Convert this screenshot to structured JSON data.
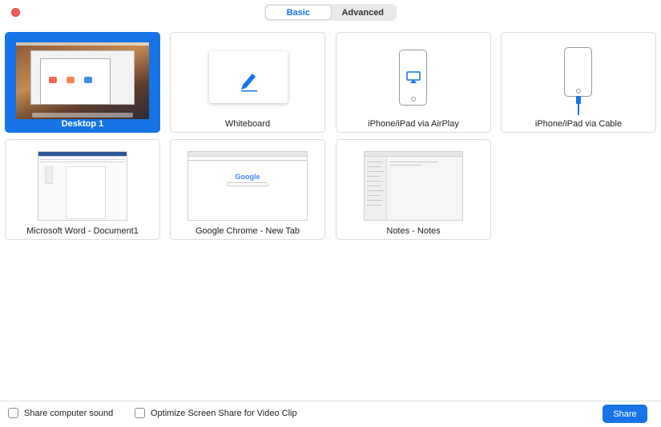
{
  "window": {
    "close_color": "#ee5d5b"
  },
  "tabs": {
    "basic": "Basic",
    "advanced": "Advanced",
    "active": "Basic"
  },
  "tiles": [
    {
      "label": "Desktop 1",
      "selected": true,
      "icon": "desktop-thumbnail"
    },
    {
      "label": "Whiteboard",
      "selected": false,
      "icon": "pen-icon"
    },
    {
      "label": "iPhone/iPad via AirPlay",
      "selected": false,
      "icon": "airplay-icon"
    },
    {
      "label": "iPhone/iPad via Cable",
      "selected": false,
      "icon": "cable-icon"
    },
    {
      "label": "Microsoft Word - Document1",
      "selected": false,
      "icon": "word-window-thumbnail"
    },
    {
      "label": "Google Chrome - New Tab",
      "selected": false,
      "icon": "chrome-window-thumbnail"
    },
    {
      "label": "Notes - Notes",
      "selected": false,
      "icon": "notes-window-thumbnail"
    }
  ],
  "chrome_thumb_text": "Google",
  "footer": {
    "share_sound": "Share computer sound",
    "optimize_video": "Optimize Screen Share for Video Clip",
    "share_sound_checked": false,
    "optimize_video_checked": false,
    "share_button": "Share"
  },
  "colors": {
    "accent": "#1774e6",
    "tile_border": "#dcdcdc"
  }
}
